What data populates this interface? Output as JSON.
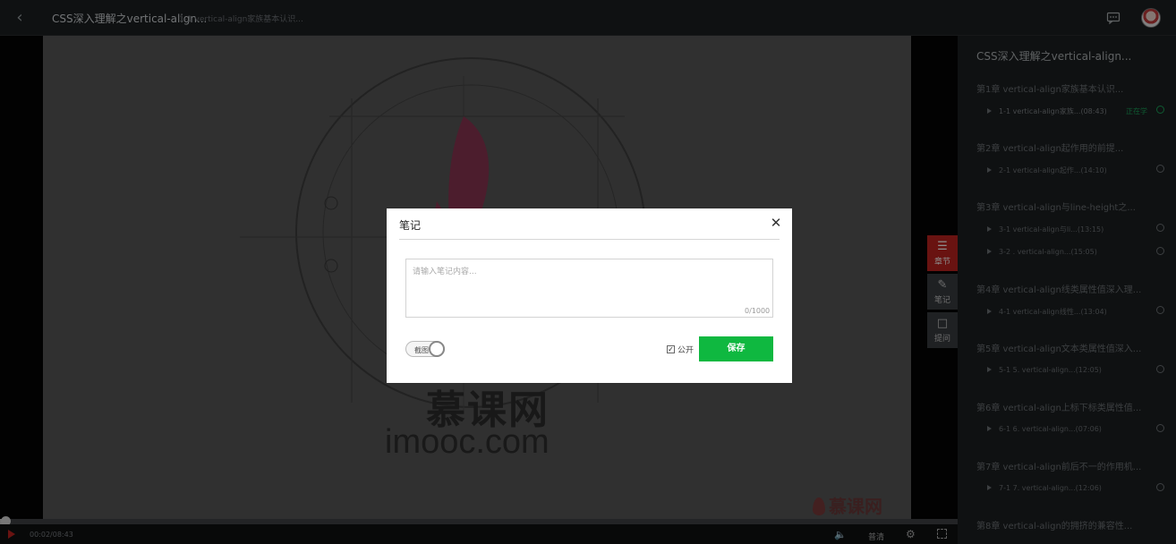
{
  "header": {
    "course_title": "CSS深入理解之vertical-align...",
    "lesson_title": "1-1 vertical-align家族基本认识..."
  },
  "video": {
    "logo_cn": "慕课网",
    "logo_en": "imooc.com",
    "watermark": "慕课网"
  },
  "tools": [
    {
      "label": "章节",
      "icon": "list-icon",
      "active": true
    },
    {
      "label": "笔记",
      "icon": "pencil-icon",
      "active": false
    },
    {
      "label": "提问",
      "icon": "question-icon",
      "active": false
    }
  ],
  "player": {
    "time": "00:02/08:43",
    "progress": 0.004,
    "quality": "普清"
  },
  "sidebar": {
    "course_title": "CSS深入理解之vertical-align...",
    "learning_label": "正在学",
    "chapters": [
      {
        "title": "第1章 vertical-align家族基本认识...",
        "lessons": [
          {
            "title": "1-1 vertical-align家族...(08:43)",
            "current": true
          }
        ]
      },
      {
        "title": "第2章 vertical-align起作用的前提...",
        "lessons": [
          {
            "title": "2-1 vertical-align起作...(14:10)"
          }
        ]
      },
      {
        "title": "第3章 vertical-align与line-height之...",
        "lessons": [
          {
            "title": "3-1 vertical-align与li...(13:15)"
          },
          {
            "title": "3-2 . vertical-align...(15:05)"
          }
        ]
      },
      {
        "title": "第4章 vertical-align线类属性值深入理...",
        "lessons": [
          {
            "title": "4-1 vertical-align线性...(13:04)"
          }
        ]
      },
      {
        "title": "第5章 vertical-align文本类属性值深入...",
        "lessons": [
          {
            "title": "5-1 5. vertical-align...(12:05)"
          }
        ]
      },
      {
        "title": "第6章 vertical-align上标下标类属性值...",
        "lessons": [
          {
            "title": "6-1 6. vertical-align...(07:06)"
          }
        ]
      },
      {
        "title": "第7章 vertical-align前后不一的作用机...",
        "lessons": [
          {
            "title": "7-1 7. vertical-align...(12:06)"
          }
        ]
      },
      {
        "title": "第8章 vertical-align的拥挤的兼容性...",
        "lessons": []
      }
    ]
  },
  "modal": {
    "title": "笔记",
    "placeholder": "请输入笔记内容...",
    "counter": "0/1000",
    "screenshot_label": "截图",
    "public_label": "公开",
    "public_checked": true,
    "save_label": "保存"
  }
}
